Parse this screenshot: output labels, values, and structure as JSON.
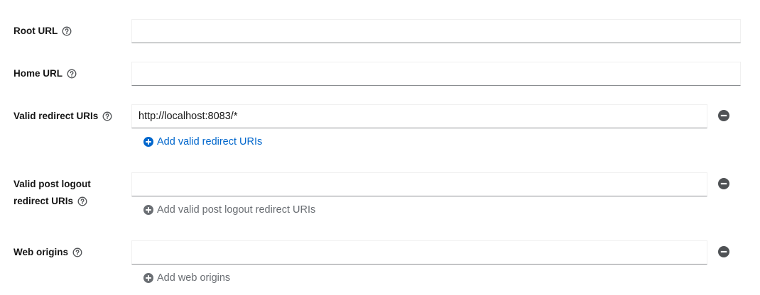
{
  "fields": {
    "root_url": {
      "label": "Root URL",
      "value": ""
    },
    "home_url": {
      "label": "Home URL",
      "value": ""
    },
    "valid_redirect_uris": {
      "label": "Valid redirect URIs",
      "value": "http://localhost:8083/*",
      "add_label": "Add valid redirect URIs"
    },
    "valid_post_logout": {
      "label_line1": "Valid post logout",
      "label_line2": "redirect URIs",
      "value": "",
      "add_label": "Add valid post logout redirect URIs"
    },
    "web_origins": {
      "label": "Web origins",
      "value": "",
      "add_label": "Add web origins"
    }
  },
  "icons": {
    "help": "help-circle-icon",
    "remove": "minus-circle-icon",
    "add": "plus-circle-icon"
  },
  "colors": {
    "link": "#0066cc",
    "disabled": "#6a6e73",
    "icon": "#4f5255"
  }
}
